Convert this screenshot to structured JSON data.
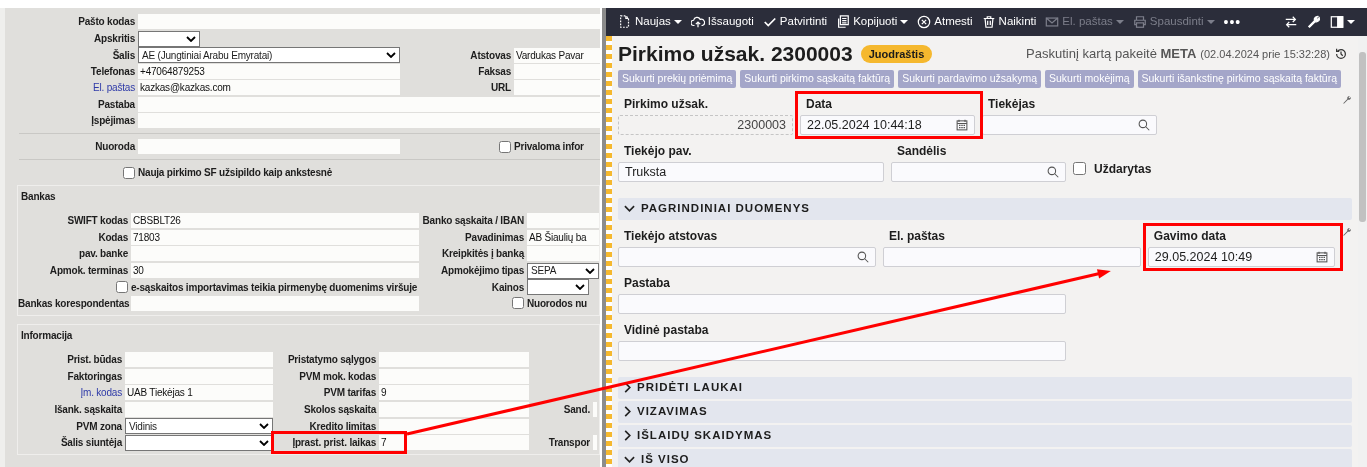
{
  "left_form": {
    "contact_rows": [
      [
        {
          "kind": "wide_text",
          "label": "Pašto kodas"
        }
      ],
      [
        {
          "kind": "small_select",
          "label": "Apskritis"
        }
      ],
      [
        {
          "kind": "select",
          "label": "Šalis",
          "value": "AE (Jungtiniai Arabu Emyratai)"
        },
        {
          "kind": "text",
          "label": "Atstovas",
          "value": "Vardukas Pavar"
        }
      ],
      [
        {
          "kind": "text",
          "label": "Telefonas",
          "value": "+47064879253"
        },
        {
          "kind": "text",
          "label": "Faksas"
        }
      ],
      [
        {
          "kind": "text",
          "label": "El. paštas",
          "link": true,
          "value": "kazkas@kazkas.com"
        },
        {
          "kind": "text",
          "label": "URL"
        }
      ],
      [
        {
          "kind": "wide_text",
          "label": "Pastaba"
        }
      ],
      [
        {
          "kind": "wide_text",
          "label": "Įspėjimas"
        }
      ]
    ],
    "reference_rows": [
      [
        {
          "kind": "text",
          "label": "Nuoroda"
        },
        {
          "kind": "checkbox",
          "label": "Privaloma infor",
          "checked": false
        }
      ]
    ],
    "option_rows": [
      [
        {
          "kind": "checkbox",
          "label": "Nauja pirkimo SF užsipildo kaip ankstesnė",
          "checked": false
        }
      ]
    ],
    "bank": {
      "legend": "Bankas",
      "rows": [
        [
          {
            "kind": "text",
            "label": "SWIFT kodas",
            "value": "CBSBLT26"
          },
          {
            "kind": "text",
            "label": "Banko sąskaita / IBAN"
          }
        ],
        [
          {
            "kind": "text",
            "label": "Kodas",
            "value": "71803"
          },
          {
            "kind": "text",
            "label": "Pavadinimas",
            "value": "AB Šiaulių ba"
          }
        ],
        [
          {
            "kind": "text",
            "label": "pav. banke"
          },
          {
            "kind": "text",
            "label": "Kreipkitės į banką"
          }
        ],
        [
          {
            "kind": "text",
            "label": "Apmok. terminas",
            "value": "30"
          },
          {
            "kind": "select",
            "label": "Apmokėjimo tipas",
            "value": "SEPA"
          }
        ],
        [
          {
            "kind": "checkbox",
            "label": "e-sąskaitos importavimas teikia pirmenybę duomenims viršuje",
            "checked": false
          },
          {
            "kind": "small_select",
            "label": "Kainos"
          }
        ],
        [
          {
            "kind": "text",
            "label": "Bankas korespondentas"
          },
          {
            "kind": "checkbox",
            "label": "Nuorodos nu",
            "checked": false
          }
        ]
      ]
    },
    "info": {
      "legend": "Informacija",
      "rows": [
        [
          {
            "kind": "text",
            "label": "Prist. būdas"
          },
          {
            "kind": "text",
            "label": "Pristatymo sąlygos"
          }
        ],
        [
          {
            "kind": "text",
            "label": "Faktoringas"
          },
          {
            "kind": "text",
            "label": "PVM mok. kodas"
          }
        ],
        [
          {
            "kind": "text",
            "label": "Įm. kodas",
            "link": true,
            "value": "UAB Tiekėjas 1"
          },
          {
            "kind": "text",
            "label": "PVM tarifas",
            "value": "9"
          }
        ],
        [
          {
            "kind": "text",
            "label": "Išank. sąskaita"
          },
          {
            "kind": "text",
            "label": "Skolos sąskaita"
          },
          {
            "kind": "text",
            "label": "Sand."
          }
        ],
        [
          {
            "kind": "select",
            "label": "PVM zona",
            "value": "Vidinis"
          },
          {
            "kind": "text",
            "label": "Kredito limitas"
          }
        ],
        [
          {
            "kind": "select",
            "label": "Šalis siuntėja"
          },
          {
            "kind": "text",
            "label": "Įprast. prist. laikas",
            "value": "7",
            "highlighted": true
          },
          {
            "kind": "text",
            "label": "Transpor"
          }
        ]
      ]
    }
  },
  "right_form": {
    "toolbar": [
      {
        "label": "Naujas",
        "dropdown": true,
        "disabled": false
      },
      {
        "label": "Išsaugoti",
        "dropdown": false,
        "disabled": false
      },
      {
        "label": "Patvirtinti",
        "dropdown": false,
        "disabled": false
      },
      {
        "label": "Kopijuoti",
        "dropdown": true,
        "disabled": false
      },
      {
        "label": "Atmesti",
        "dropdown": false,
        "disabled": false
      },
      {
        "label": "Naikinti",
        "dropdown": false,
        "disabled": false
      },
      {
        "label": "El. paštas",
        "dropdown": true,
        "disabled": true
      },
      {
        "label": "Spausdinti",
        "dropdown": true,
        "disabled": true
      }
    ],
    "more_label": "•••",
    "title": "Pirkimo užsak. 2300003",
    "status_badge": "Juodraštis",
    "last_changed_by": "Paskutinį kartą pakeitė **META**",
    "last_changed_at": "(02.04.2024 prie 15:32:28)",
    "action_buttons": [
      "Sukurti prekių priėmimą",
      "Sukurti pirkimo sąskaitą faktūrą",
      "Sukurti pardavimo užsakymą",
      "Sukurti mokėjimą",
      "Sukurti išankstinę pirkimo sąskaitą faktūrą"
    ],
    "header_rows": [
      [
        {
          "kind": "readonly",
          "label": "Pirkimo užsak.",
          "value": "2300003"
        },
        {
          "kind": "date",
          "label": "Data",
          "value": "22.05.2024 10:44:18",
          "highlighted": true
        },
        {
          "kind": "search",
          "label": "Tiekėjas"
        }
      ],
      [
        {
          "kind": "text",
          "label": "Tiekėjo pav.",
          "value": "Truksta"
        },
        {
          "kind": "search",
          "label": "Sandėlis"
        },
        {
          "kind": "checkbox",
          "label": "Uždarytas",
          "checked": false
        }
      ]
    ],
    "sections": [
      {
        "title": "PAGRINDINIAI DUOMENYS",
        "expanded": true,
        "rows": [
          [
            {
              "kind": "search",
              "label": "Tiekėjo atstovas"
            },
            {
              "kind": "text",
              "label": "El. paštas"
            },
            {
              "kind": "date",
              "label": "Gavimo data",
              "value": "29.05.2024 10:49",
              "highlighted": true
            }
          ],
          [
            {
              "kind": "text",
              "label": "Pastaba"
            }
          ],
          [
            {
              "kind": "text",
              "label": "Vidinė pastaba"
            }
          ]
        ]
      },
      {
        "title": "PRIDĖTI LAUKAI",
        "expanded": false
      },
      {
        "title": "VIZAVIMAS",
        "expanded": false
      },
      {
        "title": "IŠLAIDŲ SKAIDYMAS",
        "expanded": false
      },
      {
        "title": "IŠ VISO",
        "expanded": true
      }
    ]
  },
  "annotation_arrow": true
}
